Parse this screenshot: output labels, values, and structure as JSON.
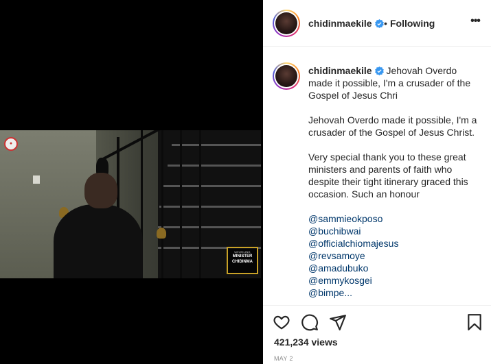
{
  "post": {
    "username": "chidinmaekile",
    "follow_separator": "•",
    "follow_status": "Following",
    "more_label": "•••"
  },
  "caption": {
    "username": "chidinmaekile",
    "intro": "Jehovah Overdo made it possible, I'm a crusader of the Gospel of Jesus Chri",
    "paragraph1": "Jehovah Overdo made it possible, I'm a crusader of the Gospel of Jesus Christ.",
    "paragraph2": "Very special thank you to these great ministers and parents of faith who despite their tight itinerary graced this occasion. Such an honour",
    "mentions": [
      "@sammieokposo",
      "@buchibwai",
      "@officialchiomajesus",
      "@revsamoye",
      "@amadubuko",
      "@emmykosgei",
      "@bimpe..."
    ]
  },
  "video": {
    "lower_third_small": "UNVEILING",
    "lower_third_line1": "MINISTER",
    "lower_third_line2": "CHIDINMA"
  },
  "stats": {
    "views": "421,234 views",
    "date": "MAY 2"
  },
  "icons": {
    "like": "heart-icon",
    "comment": "comment-icon",
    "share": "share-icon",
    "save": "bookmark-icon"
  },
  "colors": {
    "verified": "#3897f0",
    "mention": "#00376b",
    "muted": "#8e8e8e"
  }
}
